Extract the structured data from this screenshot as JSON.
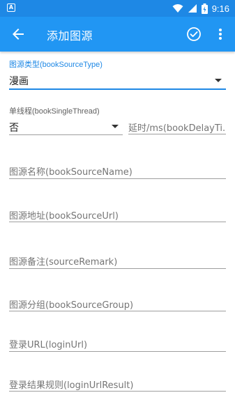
{
  "status_bar": {
    "time": "9:16",
    "icons": [
      "a-icon",
      "wifi-icon",
      "signal-icon",
      "battery-icon"
    ]
  },
  "app_bar": {
    "title": "添加图源",
    "back_icon": "arrow-left-icon",
    "save_icon": "check-circle-icon",
    "menu_icon": "more-vert-icon",
    "color": "#2196f3"
  },
  "form": {
    "source_type": {
      "label": "图源类型(bookSourceType)",
      "value": "漫画"
    },
    "single_thread": {
      "label": "单线程(bookSingleThread)",
      "value": "否"
    },
    "delay_time": {
      "hint": "延时/ms(bookDelayTi..."
    },
    "source_name": {
      "hint": "图源名称(bookSourceName)"
    },
    "source_url": {
      "hint": "图源地址(bookSourceUrl)"
    },
    "source_remark": {
      "hint": "图源备注(sourceRemark)"
    },
    "source_group": {
      "hint": "图源分组(bookSourceGroup)"
    },
    "login_url": {
      "hint": "登录URL(loginUrl)"
    },
    "login_result": {
      "hint": "登录结果规则(loginUrlResult)"
    }
  },
  "colors": {
    "accent": "#1e88e5",
    "status_bar": "#1e88e5"
  }
}
